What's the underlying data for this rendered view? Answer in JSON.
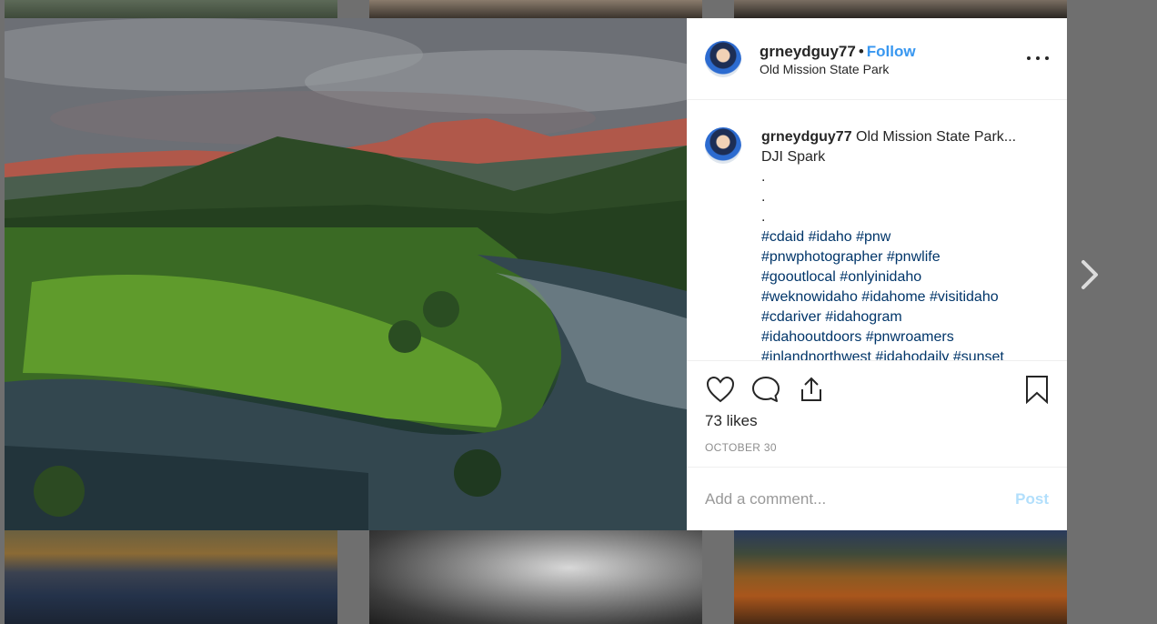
{
  "post": {
    "username": "grneydguy77",
    "separator": "•",
    "follow_label": "Follow",
    "location": "Old Mission State Park",
    "caption_title": "Old Mission State Park...",
    "caption_line2": "DJI Spark",
    "caption_dots": [
      ".",
      ".",
      "."
    ],
    "hashtags": [
      "#cdaid #idaho #pnw",
      "#pnwphotographer #pnwlife",
      "#gooutlocal #onlyinidaho",
      "#weknowidaho #idahome #visitidaho",
      "#cdariver #idahogram",
      "#idahooutdoors #pnwroamers",
      "#inlandnorthwest #idahodaily #sunset"
    ],
    "likes": "73 likes",
    "date": "OCTOBER 30"
  },
  "comment": {
    "placeholder": "Add a comment...",
    "post_label": "Post"
  },
  "icons": {
    "more": "more-options-icon",
    "like": "heart-icon",
    "comment": "comment-icon",
    "share": "share-icon",
    "save": "bookmark-icon",
    "next": "chevron-right-icon"
  },
  "colors": {
    "follow": "#3897f0",
    "hashtag": "#003569",
    "post_disabled": "#b2dffc",
    "overlay": "#6f6f6f"
  }
}
